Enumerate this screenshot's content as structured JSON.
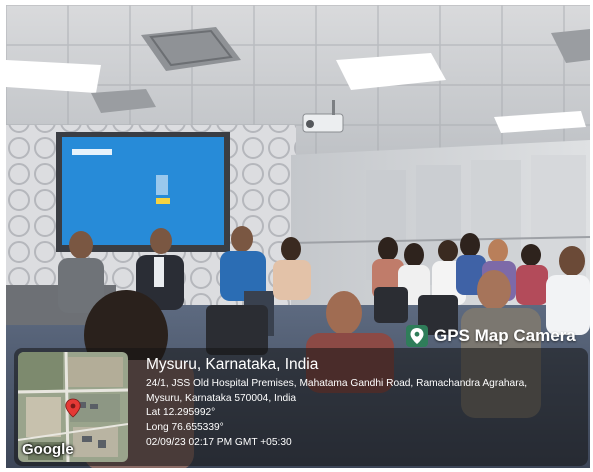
{
  "photo": {
    "description_icon": "photo-scene"
  },
  "badge": {
    "label": "GPS Map Camera",
    "icon": "map-pin-icon",
    "color": "#2f7d5a"
  },
  "map": {
    "logo_text": "Google",
    "pin_color": "#e53935"
  },
  "location": {
    "title": "Mysuru, Karnataka, India",
    "address_line1": "24/1, JSS Old Hospital Premises, Mahatama Gandhi Road, Ramachandra Agrahara,",
    "address_line2": "Mysuru, Karnataka 570004, India",
    "latitude": "Lat 12.295992°",
    "longitude": "Long 76.655339°",
    "timestamp": "02/09/23 02:17 PM GMT +05:30"
  }
}
